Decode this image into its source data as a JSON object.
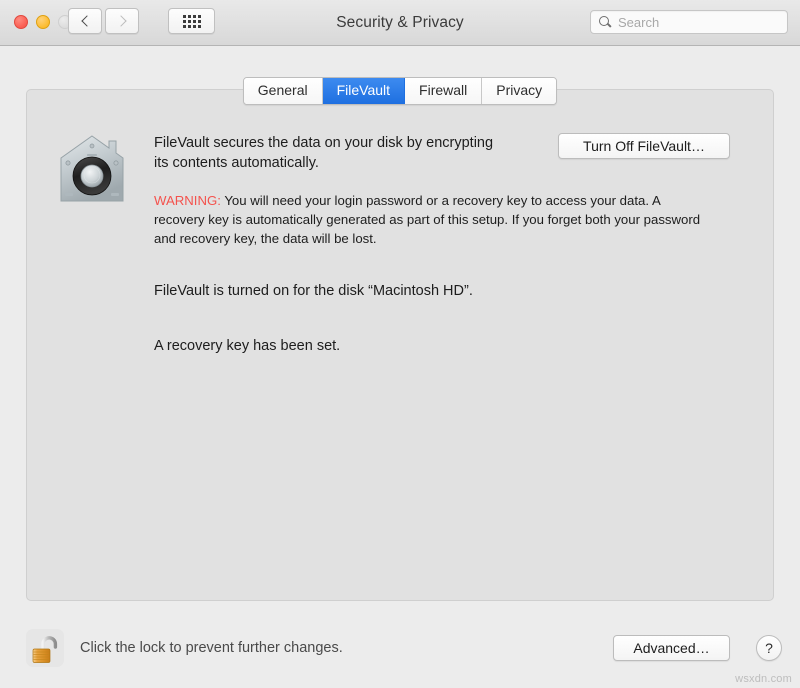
{
  "window": {
    "title": "Security & Privacy",
    "traffic_lights": {
      "close": "close-button",
      "minimize": "minimize-button",
      "zoom": "zoom-button-disabled"
    },
    "colors": {
      "background": "#ececec",
      "panel": "#e1e1e1",
      "accent_blue": "#1e6fe0",
      "warning_red": "#f4524d",
      "close_red": "#fa5d52",
      "minimize_yellow": "#fcbc30"
    }
  },
  "toolbar": {
    "back_label": "back-chevron",
    "forward_label": "forward-chevron",
    "show_all_label": "show-all-grid",
    "search": {
      "placeholder": "Search",
      "value": ""
    }
  },
  "tabs": [
    {
      "id": "general",
      "label": "General",
      "selected": false
    },
    {
      "id": "filevault",
      "label": "FileVault",
      "selected": true
    },
    {
      "id": "firewall",
      "label": "Firewall",
      "selected": false
    },
    {
      "id": "privacy",
      "label": "Privacy",
      "selected": false
    }
  ],
  "filevault": {
    "icon_name": "filevault-house-safe-icon",
    "description": "FileVault secures the data on your disk by encrypting its contents automatically.",
    "warning_label": "WARNING:",
    "warning_text": " You will need your login password or a recovery key to access your data. A recovery key is automatically generated as part of this setup. If you forget both your password and recovery key, the data will be lost.",
    "status": "FileVault is turned on for the disk “Macintosh HD”.",
    "recovery": "A recovery key has been set.",
    "turn_off_button": "Turn Off FileVault…"
  },
  "footer": {
    "lock_icon": "unlocked-padlock-icon",
    "lock_message": "Click the lock to prevent further changes.",
    "advanced_button": "Advanced…",
    "help_button": "?"
  },
  "watermark": "wsxdn.com"
}
